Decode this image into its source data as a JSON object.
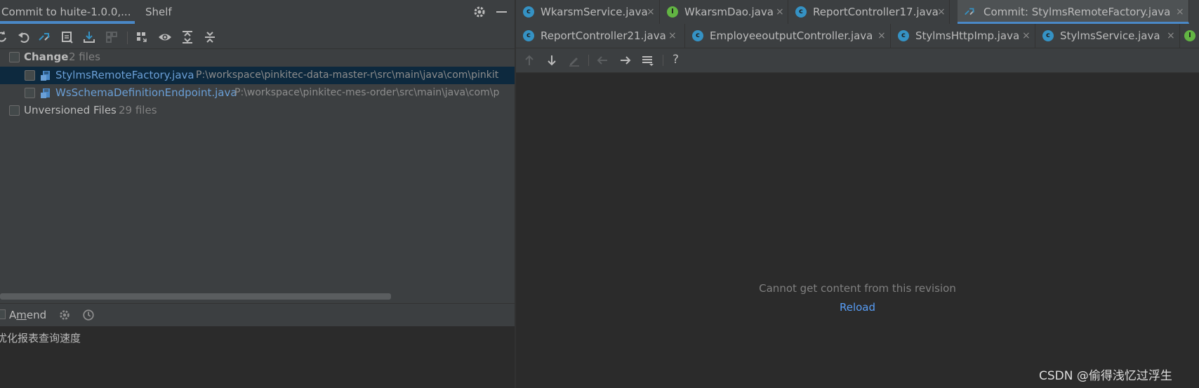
{
  "left_panel": {
    "tabs": [
      {
        "label": "Commit to huite-1.0.0,..."
      },
      {
        "label": "Shelf"
      }
    ],
    "tree": {
      "change_group": {
        "label": "Change",
        "count": "2 files"
      },
      "files": [
        {
          "name": "StylmsRemoteFactory.java",
          "path": "P:\\workspace\\pinkitec-data-master-r\\src\\main\\java\\com\\pinkit"
        },
        {
          "name": "WsSchemaDefinitionEndpoint.java",
          "path": "P:\\workspace\\pinkitec-mes-order\\src\\main\\java\\com\\p"
        }
      ],
      "unversioned_group": {
        "label": "Unversioned Files",
        "count": "29 files"
      }
    },
    "amend": {
      "label_prefix": "A",
      "label_underlined": "m",
      "label_suffix": "end"
    },
    "commit_message": "优化报表查询速度"
  },
  "editor": {
    "tabs_row1": [
      {
        "label": "WkarsmService.java",
        "kind": "C"
      },
      {
        "label": "WkarsmDao.java",
        "kind": "I"
      },
      {
        "label": "ReportController17.java",
        "kind": "C"
      },
      {
        "label": "Commit: StylmsRemoteFactory.java",
        "kind": "diff",
        "active": true
      }
    ],
    "tabs_row2": [
      {
        "label": "ReportController21.java",
        "kind": "C"
      },
      {
        "label": "EmployeeoutputController.java",
        "kind": "C"
      },
      {
        "label": "StylmsHttpImp.java",
        "kind": "C"
      },
      {
        "label": "StylmsService.java",
        "kind": "C"
      },
      {
        "label": "",
        "kind": "I"
      }
    ],
    "close_glyph": "×",
    "help_glyph": "?",
    "empty_message": "Cannot get content from this revision",
    "reload_label": "Reload"
  },
  "watermark": "CSDN @偷得浅忆过浮生",
  "colors": {
    "panel_bg": "#3c3f41",
    "editor_bg": "#2b2b2b",
    "accent": "#4a88c7",
    "link": "#589df6",
    "file_name": "#6a9fd6",
    "class_icon": "#3592c4",
    "interface_icon": "#62b543"
  }
}
